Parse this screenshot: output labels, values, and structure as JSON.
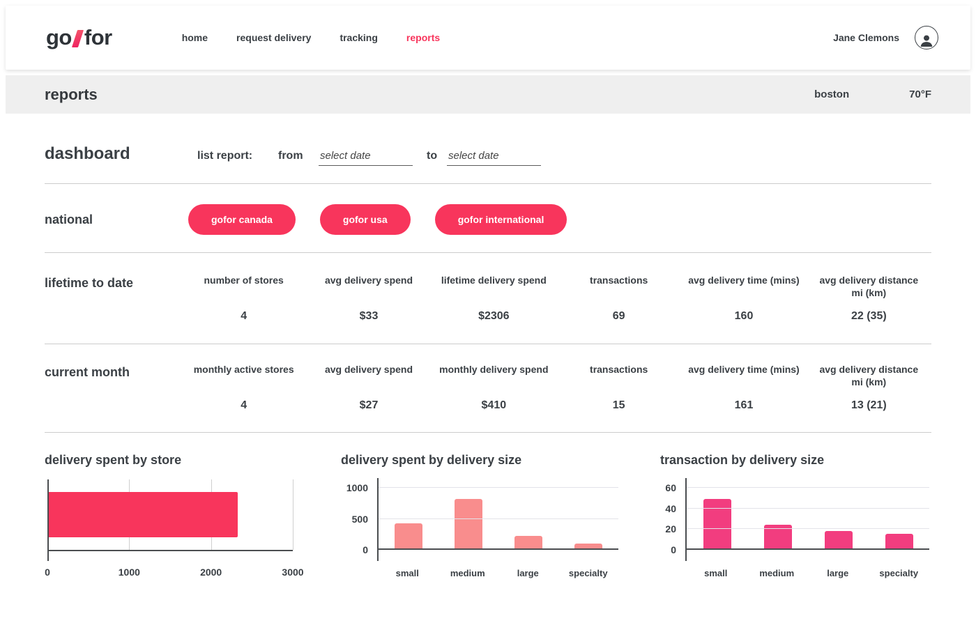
{
  "nav": {
    "logo": {
      "text_go": "go",
      "text_for": "for"
    },
    "items": [
      {
        "label": "home"
      },
      {
        "label": "request delivery"
      },
      {
        "label": "tracking"
      },
      {
        "label": "reports"
      }
    ],
    "active_item": "reports",
    "user_name": "Jane Clemons"
  },
  "reports_bar": {
    "title": "reports",
    "location": "boston",
    "temperature": "70°F"
  },
  "filter_row": {
    "heading": "dashboard",
    "list_report_label": "list report:",
    "from_label": "from",
    "to_label": "to",
    "date_placeholder": "select date"
  },
  "national": {
    "label": "national",
    "buttons": [
      "gofor canada",
      "gofor usa",
      "gofor international"
    ]
  },
  "stats_rows": [
    {
      "label": "lifetime to date",
      "stats": [
        {
          "label": "number of stores",
          "value": "4"
        },
        {
          "label": "avg delivery spend",
          "value": "$33"
        },
        {
          "label": "lifetime delivery spend",
          "value": "$2306"
        },
        {
          "label": "transactions",
          "value": "69"
        },
        {
          "label": "avg delivery time (mins)",
          "value": "160"
        },
        {
          "label": "avg delivery distance mi (km)",
          "value": "22 (35)"
        }
      ]
    },
    {
      "label": "current month",
      "stats": [
        {
          "label": "monthly active stores",
          "value": "4"
        },
        {
          "label": "avg delivery spend",
          "value": "$27"
        },
        {
          "label": "monthly delivery spend",
          "value": "$410"
        },
        {
          "label": "transactions",
          "value": "15"
        },
        {
          "label": "avg delivery time (mins)",
          "value": "161"
        },
        {
          "label": "avg delivery distance mi (km)",
          "value": "13 (21)"
        }
      ]
    }
  ],
  "chart_data": [
    {
      "type": "bar",
      "orientation": "horizontal",
      "title": "delivery spent by store",
      "values": [
        2306
      ],
      "xlim": [
        0,
        3000
      ],
      "xticks": [
        0,
        1000,
        2000,
        3000
      ],
      "bar_color": "#f8355c",
      "grid": true
    },
    {
      "type": "bar",
      "orientation": "vertical",
      "title": "delivery spent by delivery size",
      "categories": [
        "small",
        "medium",
        "large",
        "specialty"
      ],
      "values": [
        410,
        800,
        200,
        80
      ],
      "ylim": [
        0,
        1000
      ],
      "yticks": [
        0,
        500,
        1000
      ],
      "bar_color": "#f98d8d",
      "grid": true
    },
    {
      "type": "bar",
      "orientation": "vertical",
      "title": "transaction by delivery size",
      "categories": [
        "small",
        "medium",
        "large",
        "specialty"
      ],
      "values": [
        48,
        23,
        17,
        14
      ],
      "ylim": [
        0,
        60
      ],
      "yticks": [
        0,
        20,
        40,
        60
      ],
      "bar_color": "#f23d7f",
      "grid": true
    }
  ],
  "colors": {
    "brand": "#f8355c",
    "salmon": "#f98d8d",
    "magenta": "#f23d7f",
    "dark_text": "#3b4045",
    "bar_background": "#efefef",
    "divider": "#cccccc",
    "axis": "#4a4d50"
  }
}
